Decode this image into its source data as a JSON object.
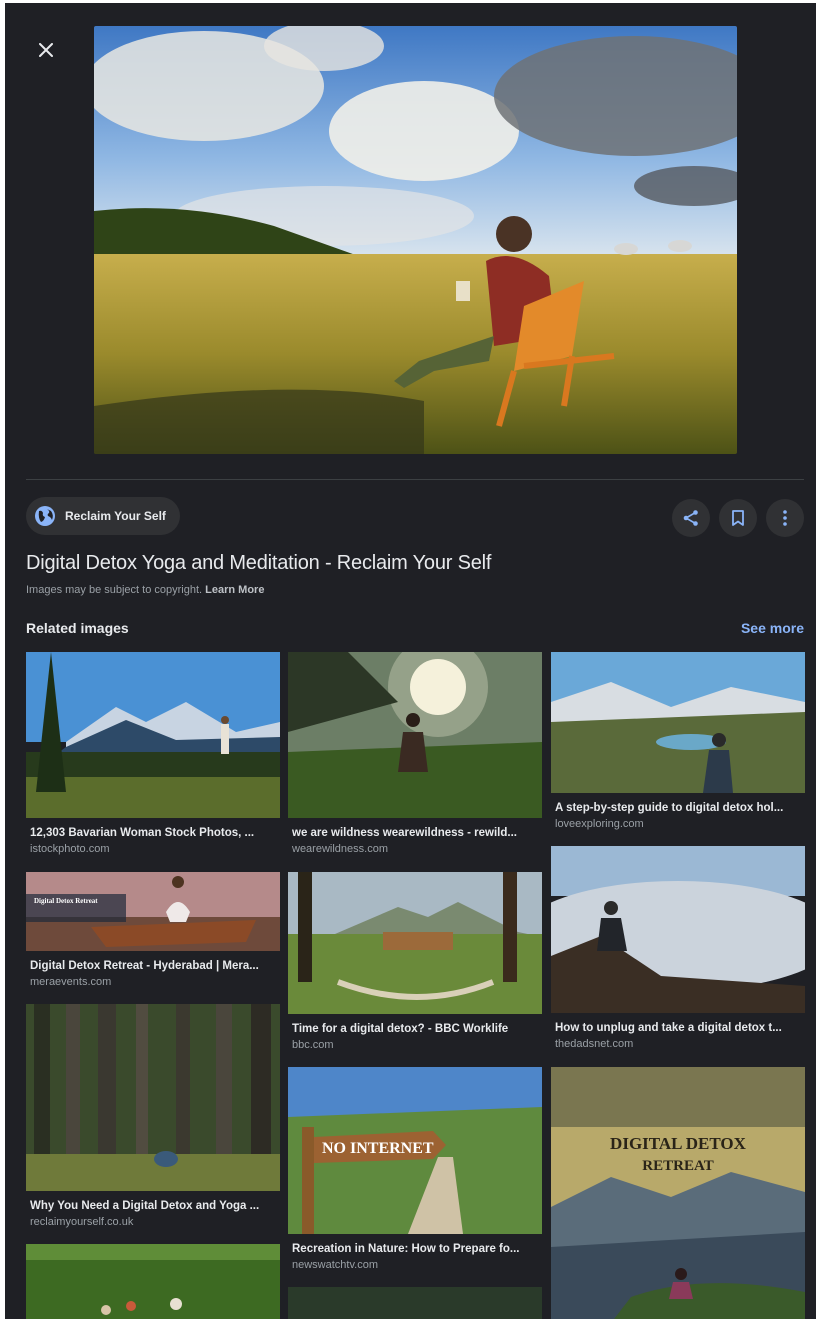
{
  "viewer": {
    "close_label": "close",
    "source_name": "Reclaim Your Self",
    "title": "Digital Detox Yoga and Meditation - Reclaim Your Self",
    "copyright_text": "Images may be subject to copyright.",
    "learn_more": "Learn More"
  },
  "related": {
    "heading": "Related images",
    "see_more": "See more",
    "items": [
      {
        "caption": "12,303 Bavarian Woman Stock Photos, ...",
        "domain": "istockphoto.com"
      },
      {
        "caption": "we are wildness wearewildness - rewild...",
        "domain": "wearewildness.com"
      },
      {
        "caption": "A step-by-step guide to digital detox hol...",
        "domain": "loveexploring.com"
      },
      {
        "caption": "Digital Detox Retreat - Hyderabad | Mera...",
        "domain": "meraevents.com",
        "overlay": "Digital Detox Retreat"
      },
      {
        "caption": "Time for a digital detox? - BBC Worklife",
        "domain": "bbc.com"
      },
      {
        "caption": "How to unplug and take a digital detox t...",
        "domain": "thedadsnet.com"
      },
      {
        "caption": "Why You Need a Digital Detox and Yoga ...",
        "domain": "reclaimyourself.co.uk"
      },
      {
        "caption": "Recreation in Nature: How to Prepare fo...",
        "domain": "newswatchtv.com",
        "overlay": "NO INTERNET"
      },
      {
        "caption": "",
        "domain": "",
        "overlay_line1": "DIGITAL DETOX",
        "overlay_line2": "RETREAT"
      }
    ]
  }
}
